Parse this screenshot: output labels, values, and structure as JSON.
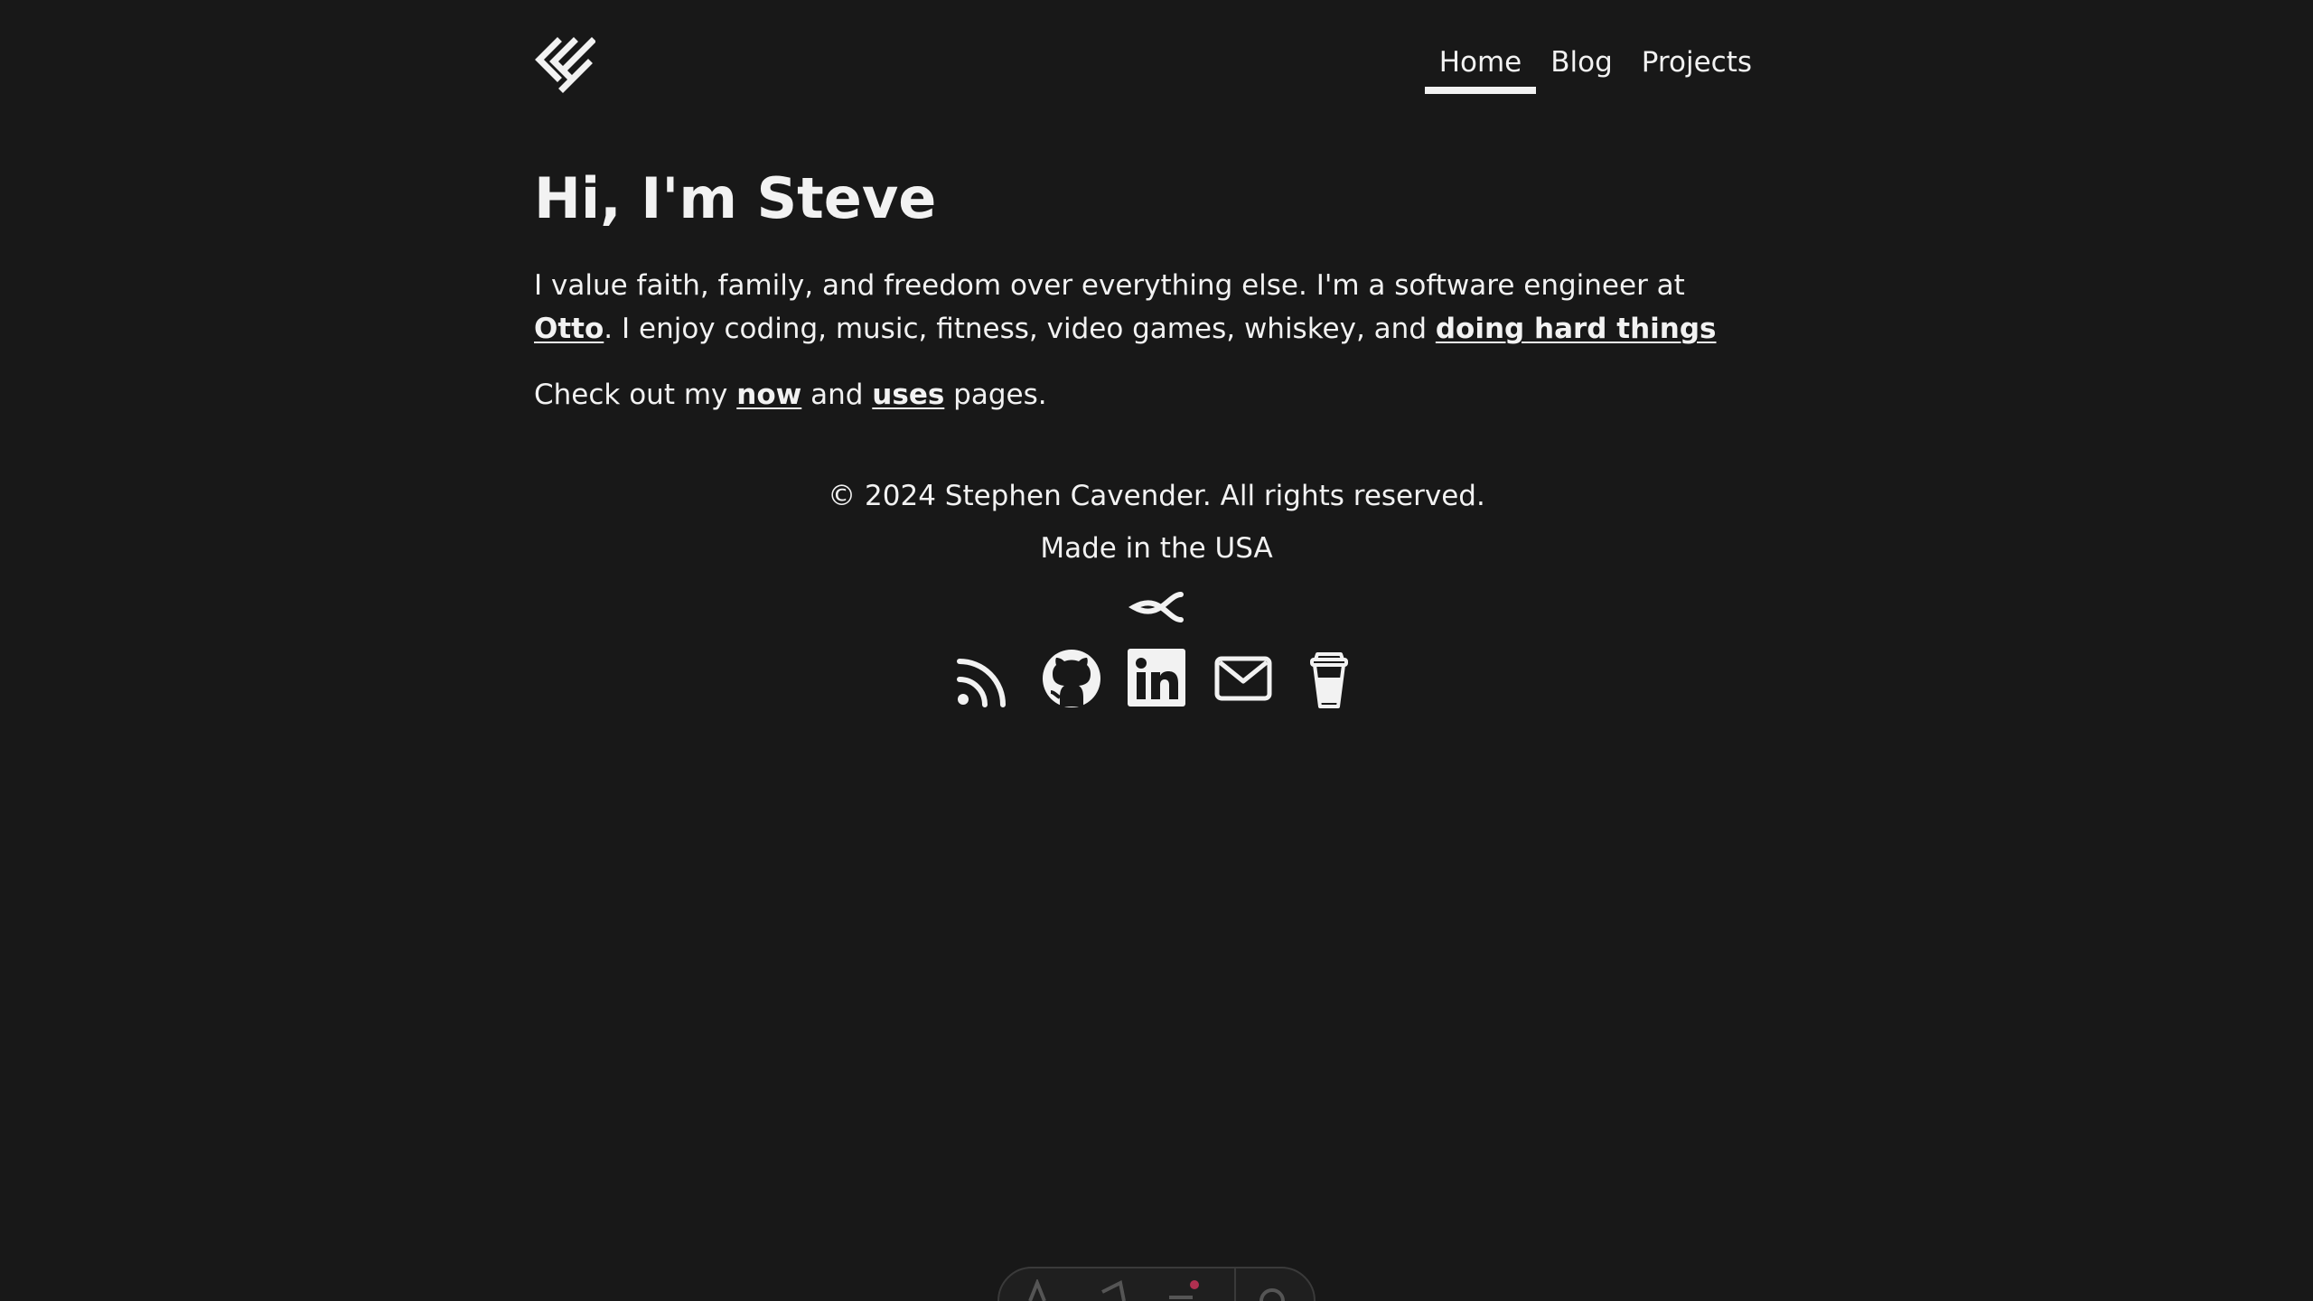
{
  "header": {
    "logo_icon": "chevrons-logo-icon",
    "nav": [
      {
        "label": "Home",
        "active": true
      },
      {
        "label": "Blog",
        "active": false
      },
      {
        "label": "Projects",
        "active": false
      }
    ]
  },
  "main": {
    "title": "Hi, I'm Steve",
    "intro": {
      "part1": "I value faith, family, and freedom over everything else. I'm a software engineer at ",
      "link1": "Otto",
      "part2": ". I enjoy coding, music, fitness, video games, whiskey, and ",
      "link2": "doing hard things"
    },
    "pages_line": {
      "part1": "Check out my ",
      "link1": "now",
      "part2": " and ",
      "link2": "uses",
      "part3": " pages."
    }
  },
  "footer": {
    "copyright": "© 2024 Stephen Cavender. All rights reserved.",
    "made_in": "Made in the USA",
    "fish_icon": "ichthys-fish-icon",
    "socials": [
      {
        "icon": "rss-icon"
      },
      {
        "icon": "github-icon"
      },
      {
        "icon": "linkedin-icon"
      },
      {
        "icon": "mail-icon"
      },
      {
        "icon": "coffee-cup-icon"
      }
    ]
  },
  "colors": {
    "background": "#181818",
    "text": "#f2f2f2",
    "widget_dot": "#b03050"
  }
}
